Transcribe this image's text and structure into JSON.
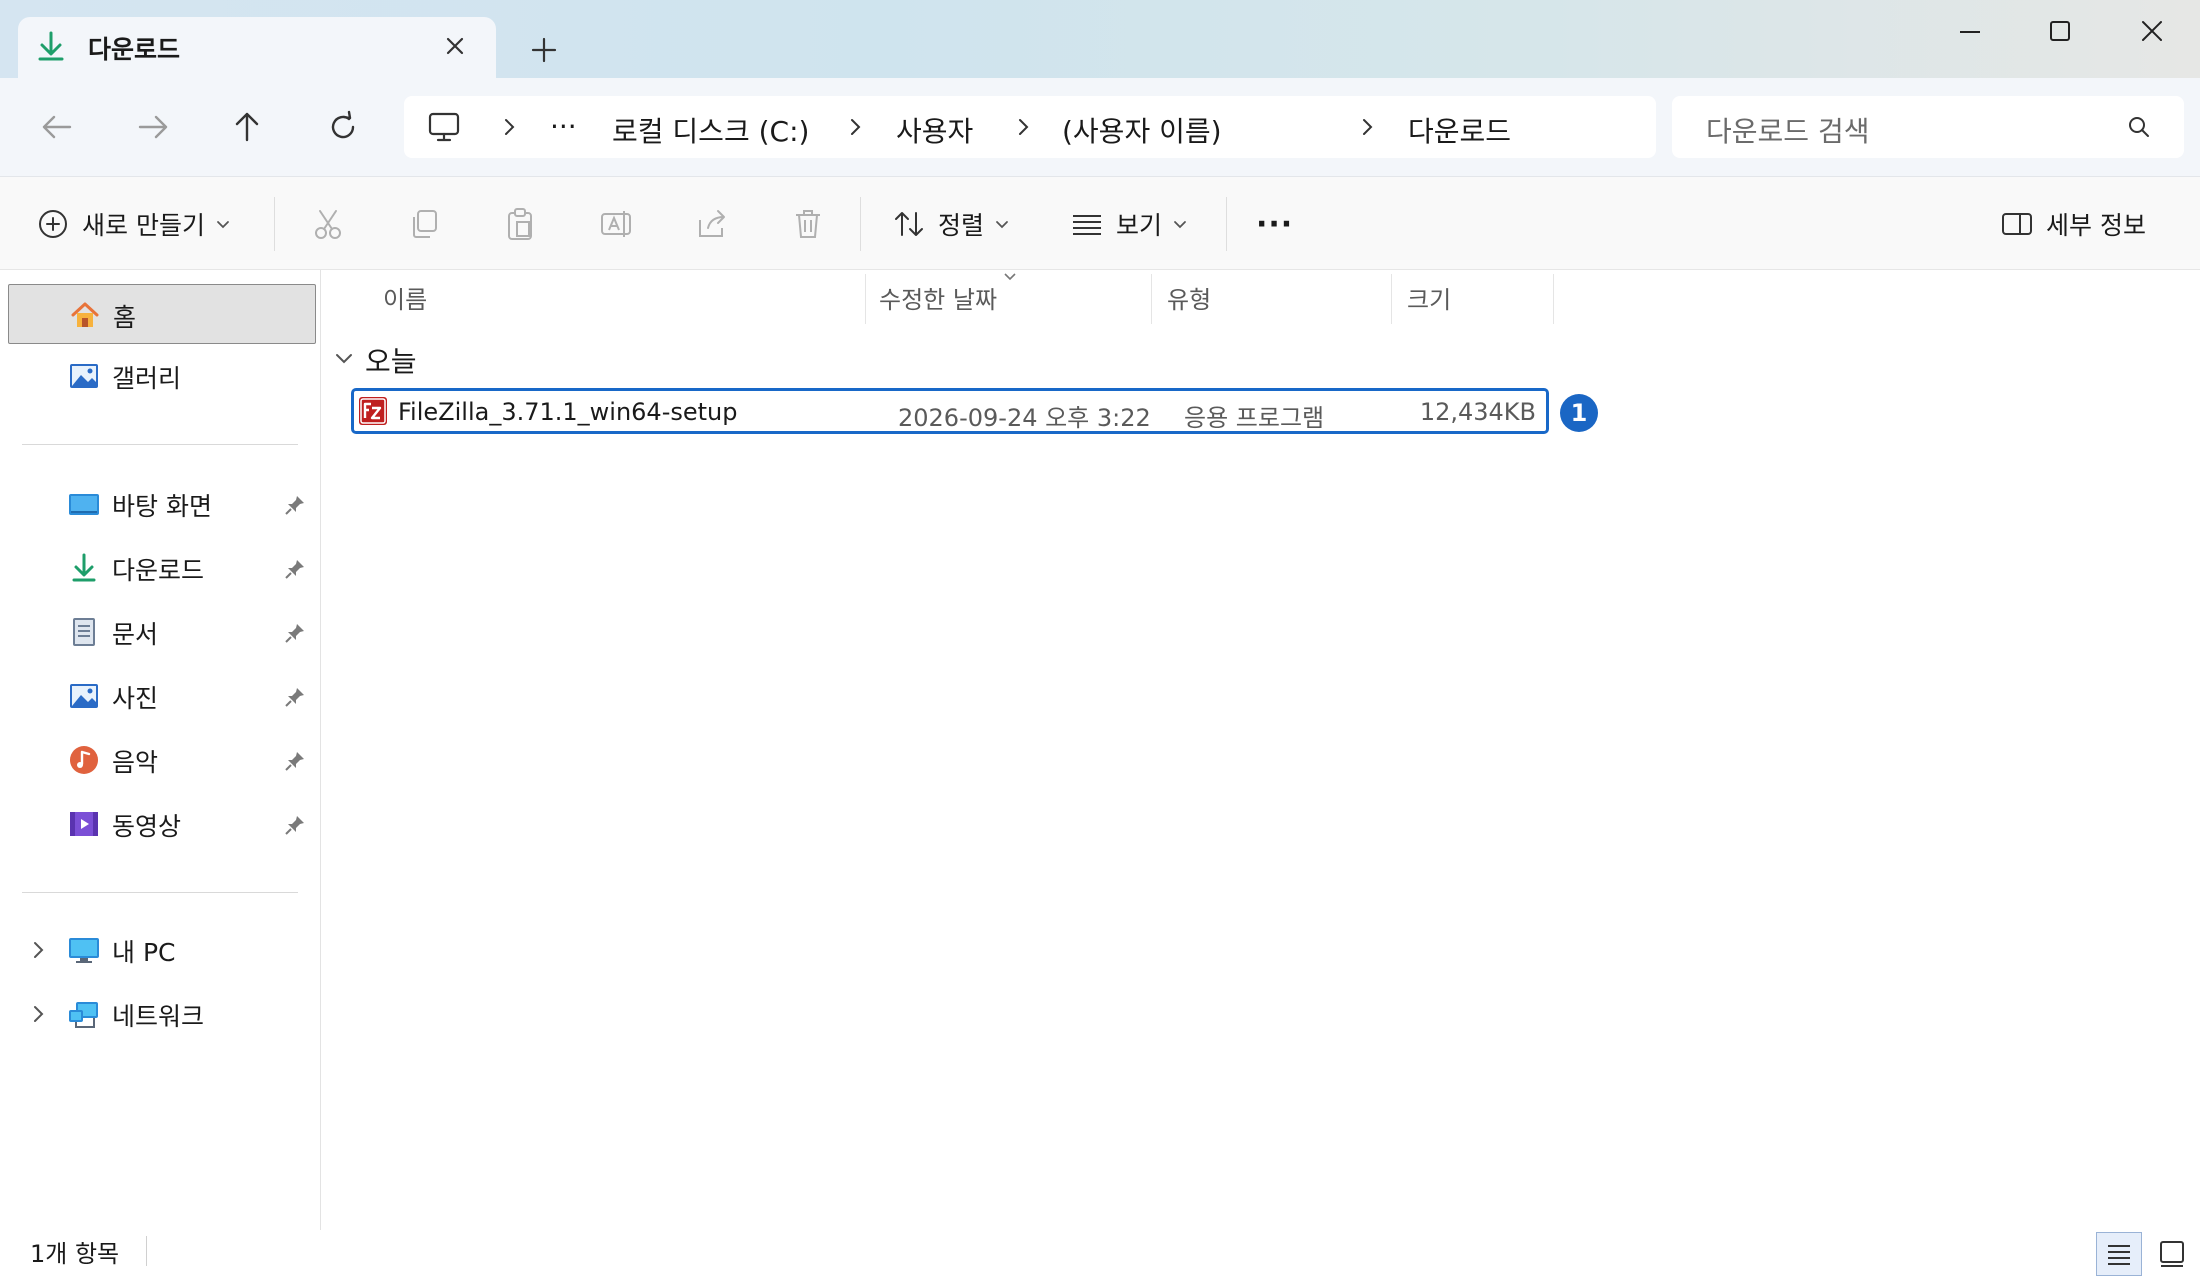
{
  "tab": {
    "title": "다운로드",
    "icon": "download-icon"
  },
  "window_controls": {
    "minimize": "minimize-icon",
    "maximize": "maximize-icon",
    "close": "close-icon"
  },
  "address": {
    "crumbs": [
      "로컬 디스크 (C:)",
      "사용자",
      "(사용자 이름)",
      "다운로드"
    ],
    "overflow": "···"
  },
  "search": {
    "placeholder": "다운로드 검색"
  },
  "command_bar": {
    "new_label": "새로 만들기",
    "sort_label": "정렬",
    "view_label": "보기",
    "more": "···",
    "details_label": "세부 정보"
  },
  "sidebar": {
    "home": "홈",
    "gallery": "갤러리",
    "pinned": [
      {
        "label": "바탕 화면",
        "icon": "desktop-icon"
      },
      {
        "label": "다운로드",
        "icon": "download-icon"
      },
      {
        "label": "문서",
        "icon": "document-icon"
      },
      {
        "label": "사진",
        "icon": "pictures-icon"
      },
      {
        "label": "음악",
        "icon": "music-icon"
      },
      {
        "label": "동영상",
        "icon": "video-icon"
      }
    ],
    "this_pc": "내 PC",
    "network": "네트워크"
  },
  "columns": {
    "name": "이름",
    "modified": "수정한 날짜",
    "type": "유형",
    "size": "크기"
  },
  "group": {
    "label": "오늘"
  },
  "file": {
    "name": "FileZilla_3.71.1_win64-setup",
    "modified": "2026-09-24 오후 3:22",
    "type": "응용 프로그램",
    "size": "12,434KB",
    "badge": "1"
  },
  "status": {
    "count": "1개 항목"
  },
  "colors": {
    "accent": "#1868c8",
    "badge": "#1a66c4",
    "download_green": "#1e9e6a"
  }
}
